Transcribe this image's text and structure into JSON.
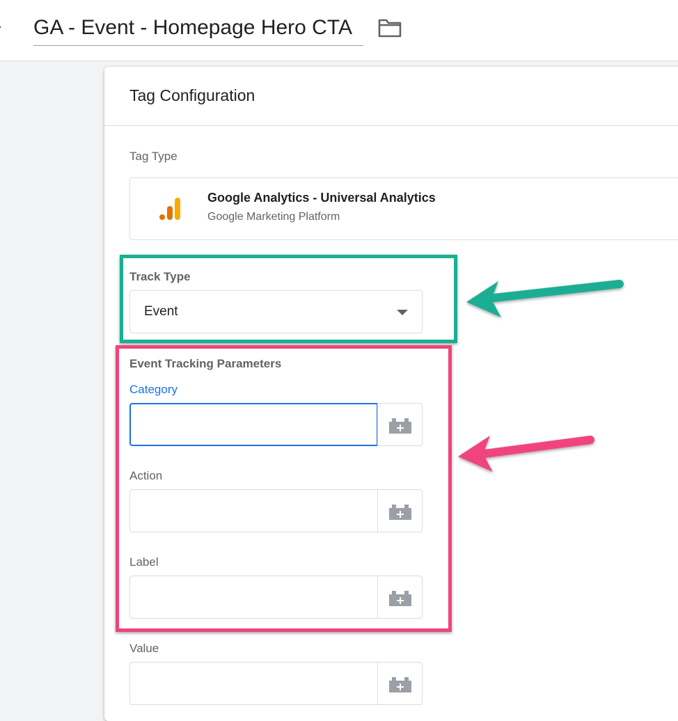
{
  "header": {
    "tag_name": "GA - Event - Homepage Hero CTA",
    "close_icon": "close-icon",
    "folder_icon": "folder-icon"
  },
  "card": {
    "title": "Tag Configuration"
  },
  "tag_type": {
    "label": "Tag Type",
    "name": "Google Analytics - Universal Analytics",
    "provider": "Google Marketing Platform",
    "icon": "google-analytics-icon"
  },
  "track_type": {
    "label": "Track Type",
    "value": "Event"
  },
  "event_params": {
    "heading": "Event Tracking Parameters",
    "category": {
      "label": "Category",
      "value": ""
    },
    "action": {
      "label": "Action",
      "value": ""
    },
    "label": {
      "label": "Label",
      "value": ""
    },
    "value": {
      "label": "Value",
      "value": ""
    }
  },
  "annotations": {
    "track_type_highlight_color": "#1aae94",
    "event_params_highlight_color": "#f0447b"
  },
  "colors": {
    "focus_blue": "#1a73e8",
    "ga_orange": "#f9ab00",
    "ga_dark_orange": "#e37400"
  }
}
